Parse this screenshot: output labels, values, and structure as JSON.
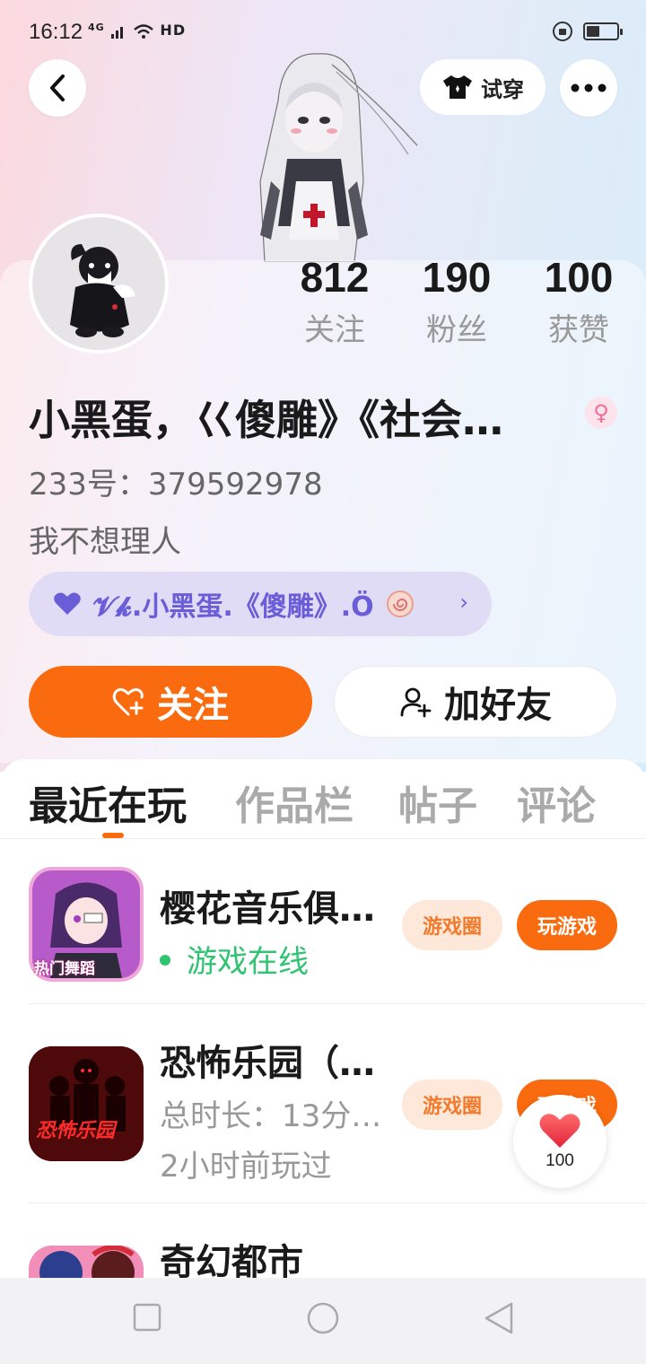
{
  "status_bar": {
    "time": "16:12",
    "network": "4G",
    "network_label": "HD"
  },
  "header": {
    "try_on_label": "试穿"
  },
  "stats": [
    {
      "value": "812",
      "label": "关注"
    },
    {
      "value": "190",
      "label": "粉丝"
    },
    {
      "value": "100",
      "label": "获赞"
    }
  ],
  "profile": {
    "nickname": "小黑蛋，巜傻雕》《社会…",
    "uid": "233号：379592978",
    "bio": "我不想理人",
    "gender_symbol": "♀",
    "club_name": "𝓥𝓴.小黑蛋.《傻雕》.Ö"
  },
  "actions": {
    "follow_label": "关注",
    "add_friend_label": "加好友"
  },
  "tabs": [
    {
      "label": "最近在玩",
      "active": true
    },
    {
      "label": "作品栏",
      "active": false
    },
    {
      "label": "帖子",
      "active": false
    },
    {
      "label": "评论",
      "active": false
    }
  ],
  "games": [
    {
      "title": "樱花音乐俱…",
      "status": "游戏在线",
      "icon_text": "热门舞蹈",
      "circle_label": "游戏圈",
      "play_label": "玩游戏"
    },
    {
      "title": "恐怖乐园（…",
      "total_time": "总时长：13分…",
      "last_played": "2小时前玩过",
      "icon_text": "恐怖乐园",
      "circle_label": "游戏圈",
      "play_label": "玩游戏"
    },
    {
      "title": "奇幻都市"
    }
  ],
  "like_fab": {
    "count": "100"
  },
  "colors": {
    "accent": "#fa6a0e",
    "online": "#2fc472",
    "club": "#6a5dd8"
  }
}
